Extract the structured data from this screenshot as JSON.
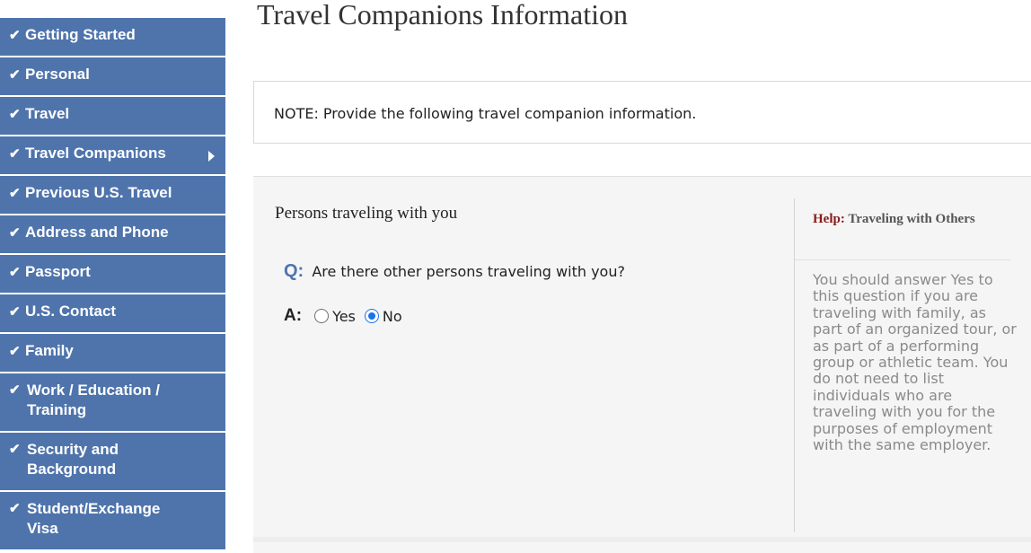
{
  "sidebar": {
    "items": [
      {
        "label": "Getting Started",
        "checked": true
      },
      {
        "label": "Personal",
        "checked": true
      },
      {
        "label": "Travel",
        "checked": true
      },
      {
        "label": "Travel Companions",
        "checked": true,
        "active": true
      },
      {
        "label": "Previous U.S. Travel",
        "checked": true
      },
      {
        "label": "Address and Phone",
        "checked": true
      },
      {
        "label": "Passport",
        "checked": true
      },
      {
        "label": "U.S. Contact",
        "checked": true
      },
      {
        "label": "Family",
        "checked": true
      },
      {
        "label": "Work / Education / Training",
        "checked": true
      },
      {
        "label": "Security and Background",
        "checked": true
      },
      {
        "label": "Student/Exchange Visa",
        "checked": true
      }
    ],
    "check_glyph": "✔"
  },
  "page": {
    "title": "Travel Companions Information"
  },
  "note": {
    "text": "NOTE: Provide the following travel companion information."
  },
  "form": {
    "section_title": "Persons traveling with you",
    "question_marker": "Q:",
    "question": "Are there other persons traveling with you?",
    "answer_marker": "A:",
    "options": [
      {
        "label": "Yes",
        "selected": false
      },
      {
        "label": "No",
        "selected": true
      }
    ]
  },
  "help": {
    "label": "Help:",
    "title": "Traveling with Others",
    "body": "You should answer Yes to this question if you are traveling with family, as part of an organized tour, or as part of a performing group or athletic team. You do not need to list individuals who are traveling with you for the purposes of employment with the same employer."
  },
  "colors": {
    "nav_bg": "#4f74ac",
    "accent": "#4f74ac",
    "help_label": "#8b1a1a",
    "radio_selected": "#1a73e8"
  }
}
